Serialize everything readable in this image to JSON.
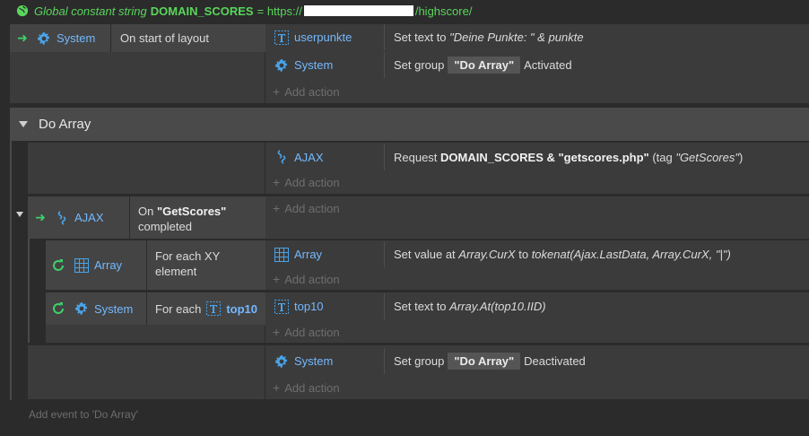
{
  "global_constant": {
    "prefix": "Global constant string",
    "name": "DOMAIN_SCORES",
    "equals": "=",
    "value_start": "https://",
    "value_end": "/highscore/"
  },
  "event1": {
    "condition": {
      "object": "System",
      "text": "On start of layout"
    },
    "actions": [
      {
        "object": "userpunkte",
        "text_before": "Set text to ",
        "text_italic": "\"Deine Punkte: \" & punkte"
      },
      {
        "object": "System",
        "text_before": "Set group",
        "badge": "\"Do Array\"",
        "text_after": "Activated"
      }
    ],
    "add_action": "Add action"
  },
  "group": {
    "title": "Do Array"
  },
  "event2": {
    "actions": [
      {
        "object": "AJAX",
        "text_before": "Request ",
        "text_bold": "DOMAIN_SCORES & \"getscores.php\"",
        "text_after": " (tag ",
        "text_italic": "\"GetScores\"",
        "text_end": ")"
      }
    ],
    "add_action": "Add action"
  },
  "event3": {
    "condition": {
      "object": "AJAX",
      "text_before": "On ",
      "text_bold": "\"GetScores\"",
      "text_after": "completed"
    },
    "add_action": "Add action",
    "sub1": {
      "condition": {
        "object": "Array",
        "text_line1": "For each XY",
        "text_line2": "element"
      },
      "action": {
        "object": "Array",
        "text_before": "Set value at ",
        "text_italic": "Array.CurX",
        "text_mid": " to ",
        "text_italic2": "tokenat(Ajax.LastData, Array.CurX, \"|\")"
      },
      "add_action": "Add action"
    },
    "sub2": {
      "condition": {
        "object": "System",
        "text_before": "For each",
        "text_object": "top10"
      },
      "action": {
        "object": "top10",
        "text_before": "Set text to ",
        "text_italic": "Array.At(top10.IID)"
      },
      "add_action": "Add action"
    }
  },
  "event4": {
    "action": {
      "object": "System",
      "text_before": "Set group",
      "badge": "\"Do Array\"",
      "text_after": "Deactivated"
    },
    "add_action": "Add action"
  },
  "footer": {
    "add_event": "Add event to 'Do Array'"
  },
  "colors": {
    "accent_green": "#59d65c",
    "object_blue": "#73b9ff",
    "row_bg": "#3b3b3b",
    "bg": "#2b2b2b"
  },
  "icons": [
    "globe-icon",
    "gear-icon",
    "text-icon",
    "ajax-icon",
    "array-icon",
    "loop-icon",
    "trigger-arrow-icon"
  ]
}
